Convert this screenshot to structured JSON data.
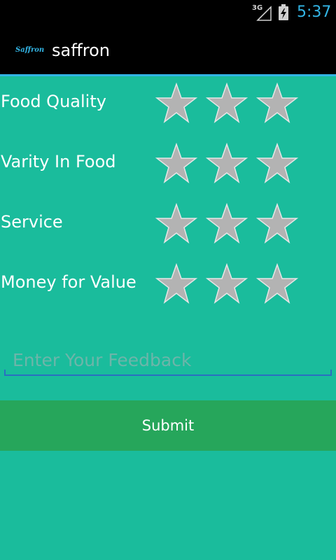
{
  "status_bar": {
    "network": "3G",
    "time": "5:37",
    "colors": {
      "time": "#33b5e5"
    }
  },
  "action_bar": {
    "logo_text": "Saffron",
    "title": "saffron"
  },
  "ratings": [
    {
      "label": "Food Quality",
      "stars_total": 3,
      "stars_selected": 0
    },
    {
      "label": "Varity In Food",
      "stars_total": 3,
      "stars_selected": 0
    },
    {
      "label": "Service",
      "stars_total": 3,
      "stars_selected": 0
    },
    {
      "label": "Money for Value",
      "stars_total": 3,
      "stars_selected": 0
    }
  ],
  "feedback": {
    "value": "",
    "placeholder": "Enter Your Feedback"
  },
  "submit_label": "Submit",
  "colors": {
    "background": "#1abc9c",
    "button": "#26a65b",
    "star_empty": "#b3b3b3",
    "accent": "#33b5e5"
  }
}
